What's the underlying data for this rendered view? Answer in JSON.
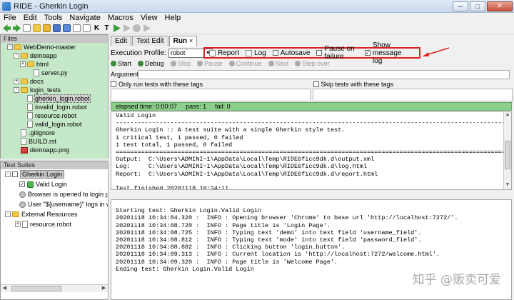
{
  "window": {
    "title": "RIDE - Gherkin Login"
  },
  "menu": [
    "File",
    "Edit",
    "Tools",
    "Navigate",
    "Macros",
    "View",
    "Help"
  ],
  "files_panel": {
    "header": "Files",
    "items": [
      {
        "label": "WebDemo-master",
        "kind": "folder",
        "indent": 1,
        "expander": "-"
      },
      {
        "label": "demoapp",
        "kind": "folder",
        "indent": 2,
        "expander": "-"
      },
      {
        "label": "html",
        "kind": "folder",
        "indent": 3,
        "expander": "+"
      },
      {
        "label": "server.py",
        "kind": "file",
        "indent": 4
      },
      {
        "label": "docs",
        "kind": "folder",
        "indent": 2,
        "expander": "+"
      },
      {
        "label": "login_tests",
        "kind": "folder",
        "indent": 2,
        "expander": "-"
      },
      {
        "label": "gherkin_login.robot",
        "kind": "file",
        "indent": 3,
        "selected": true
      },
      {
        "label": "invalid_login.robot",
        "kind": "file",
        "indent": 3
      },
      {
        "label": "resource.robot",
        "kind": "file",
        "indent": 3
      },
      {
        "label": "valid_login.robot",
        "kind": "file",
        "indent": 3
      },
      {
        "label": ".gitignore",
        "kind": "file",
        "indent": 2
      },
      {
        "label": "BUILD.rst",
        "kind": "file",
        "indent": 2
      },
      {
        "label": "demoapp.png",
        "kind": "image",
        "indent": 2
      }
    ]
  },
  "suites_panel": {
    "header": "Test Suites",
    "root": "Gherkin Login",
    "test": "Valid Login",
    "keywords": [
      "Browser is opened to login p",
      "User \"${username}\" logs in w"
    ],
    "external": "External Resources",
    "resource": "resource.robot"
  },
  "tabs": [
    {
      "label": "Edit"
    },
    {
      "label": "Text Edit"
    },
    {
      "label": "Run",
      "active": true,
      "close": "×"
    }
  ],
  "run": {
    "profile_label": "Execution Profile:",
    "profile_value": "robot",
    "options": [
      {
        "label": "Report",
        "checked": false,
        "checkbox": false
      },
      {
        "label": "Log",
        "checked": false,
        "checkbox": false
      },
      {
        "label": "Autosave",
        "checked": false,
        "checkbox": true
      },
      {
        "label": "Pause on failure",
        "checked": false,
        "checkbox": true
      },
      {
        "label": "Show message log",
        "checked": true,
        "checkbox": true
      }
    ],
    "buttons": [
      {
        "label": "Start",
        "enabled": true
      },
      {
        "label": "Debug",
        "enabled": true
      },
      {
        "label": "Stop",
        "enabled": false
      },
      {
        "label": "Pause",
        "enabled": false
      },
      {
        "label": "Continue",
        "enabled": false
      },
      {
        "label": "Next",
        "enabled": false
      },
      {
        "label": "Step over",
        "enabled": false
      }
    ],
    "arguments_label": "Arguments:",
    "only_run_label": "Only run tests with these tags",
    "skip_label": "Skip tests with these tags",
    "elapsed": "elapsed time: 0:00:07",
    "pass": "pass: 1",
    "fail": "fail: 0"
  },
  "output_lines": [
    "Valid Login",
    "------------------------------------------------------------------------------------------------------------",
    "Gherkin Login :: A test suite with a single Gherkin style test.",
    "1 critical test, 1 passed, 0 failed",
    "1 test total, 1 passed, 0 failed",
    "============================================================================================================",
    "Output:  C:\\Users\\ADMINI~1\\AppData\\Local\\Temp\\RIDE6ficc9dk.d\\output.xml",
    "Log:     C:\\Users\\ADMINI~1\\AppData\\Local\\Temp\\RIDE6ficc9dk.d\\log.html",
    "Report:  C:\\Users\\ADMINI~1\\AppData\\Local\\Temp\\RIDE6ficc9dk.d\\report.html",
    "",
    "Test finished 20201118 10:34:11"
  ],
  "log_lines": [
    "",
    "Starting test: Gherkin Login.Valid Login",
    "20201118 10:34:04.320 :  INFO : Opening browser 'Chrome' to base url 'http://localhost:7272/'.",
    "20201118 10:34:08.720 :  INFO : Page title is 'Login Page'.",
    "20201118 10:34:08.725 :  INFO : Typing text 'demo' into text field 'username_field'.",
    "20201118 10:34:08.812 :  INFO : Typing text 'mode' into text field 'password_field'.",
    "20201118 10:34:08.882 :  INFO : Clicking button 'login_button'.",
    "20201118 10:34:09.313 :  INFO : Current location is 'http://localhost:7272/welcome.html'.",
    "20201118 10:34:09.320 :  INFO : Page title is 'Welcome Page'.",
    "Ending test: Gherkin Login.Valid Login"
  ],
  "watermark": "知乎 @贩卖可爱"
}
